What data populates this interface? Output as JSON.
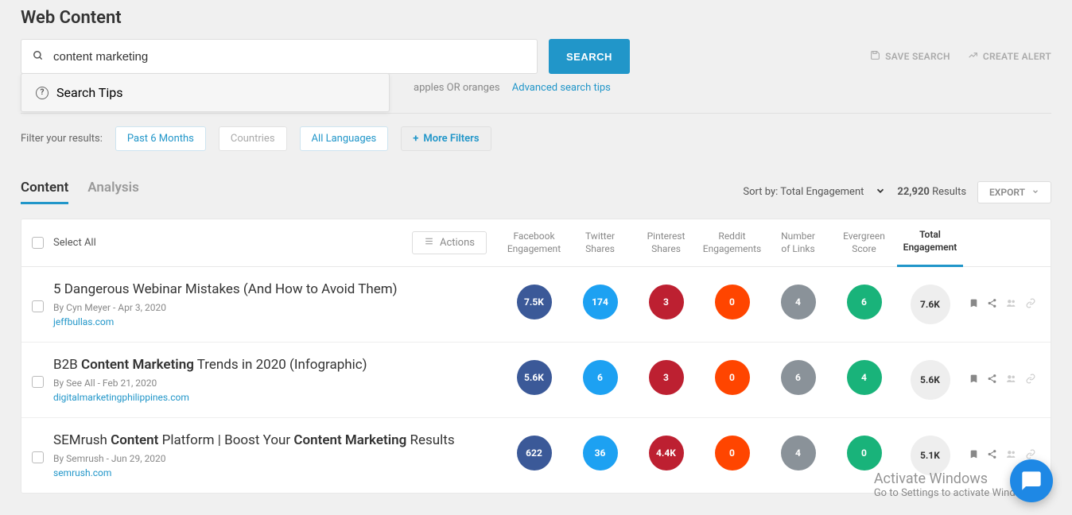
{
  "page_title": "Web Content",
  "search": {
    "value": "content marketing",
    "button": "SEARCH",
    "tips_label": "Search Tips"
  },
  "top_actions": {
    "save": "SAVE SEARCH",
    "alert": "CREATE ALERT"
  },
  "hint": {
    "text": "apples OR oranges",
    "link": "Advanced search tips"
  },
  "filters": {
    "label": "Filter your results:",
    "period": "Past 6 Months",
    "countries": "Countries",
    "languages": "All Languages",
    "more": "More Filters"
  },
  "tabs": {
    "content": "Content",
    "analysis": "Analysis"
  },
  "sort": {
    "label": "Sort by:",
    "value": "Total Engagement"
  },
  "results": {
    "count": "22,920",
    "label": "Results"
  },
  "export": "EXPORT",
  "thead": {
    "select_all": "Select All",
    "actions": "Actions",
    "cols": {
      "fb": "Facebook\nEngagement",
      "tw": "Twitter\nShares",
      "pin": "Pinterest\nShares",
      "rd": "Reddit\nEngagements",
      "links": "Number\nof Links",
      "ever": "Evergreen\nScore",
      "total": "Total\nEngagement"
    }
  },
  "rows": [
    {
      "title_html": "5 Dangerous Webinar Mistakes (And How to Avoid Them)",
      "by": "By Cyn Meyer - Apr 3, 2020",
      "domain": "jeffbullas.com",
      "fb": "7.5K",
      "tw": "174",
      "pin": "3",
      "rd": "0",
      "links": "4",
      "ever": "6",
      "total": "7.6K"
    },
    {
      "title_html": "B2B <b>Content Marketing</b> Trends in 2020 (Infographic)",
      "by": "By See All - Feb 21, 2020",
      "domain": "digitalmarketingphilippines.com",
      "fb": "5.6K",
      "tw": "6",
      "pin": "3",
      "rd": "0",
      "links": "6",
      "ever": "4",
      "total": "5.6K"
    },
    {
      "title_html": "SEMrush <b>Content</b> Platform | Boost Your <b>Content Marketing</b> Results",
      "by": "By Semrush - Jun 29, 2020",
      "domain": "semrush.com",
      "fb": "622",
      "tw": "36",
      "pin": "4.4K",
      "rd": "0",
      "links": "4",
      "ever": "0",
      "total": "5.1K"
    }
  ],
  "watermark": {
    "t1": "Activate Windows",
    "t2": "Go to Settings to activate Windows."
  }
}
